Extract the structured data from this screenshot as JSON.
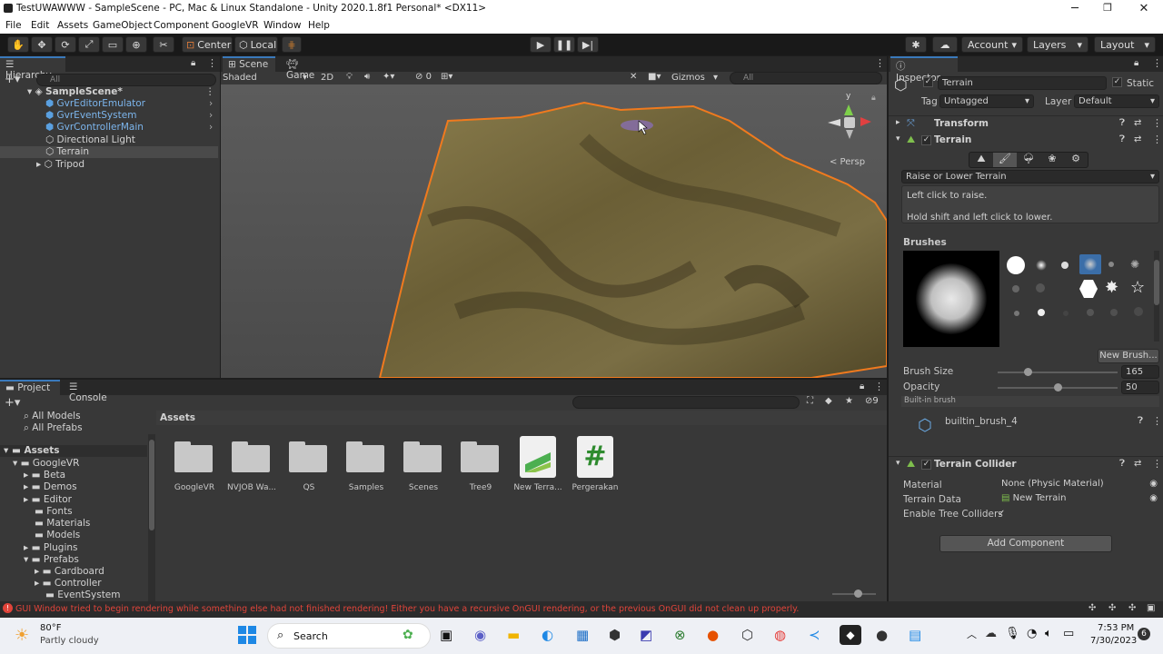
{
  "window": {
    "title": "TestUWAWWW - SampleScene - PC, Mac & Linux Standalone - Unity 2020.1.8f1 Personal* <DX11>"
  },
  "menu": [
    "File",
    "Edit",
    "Assets",
    "GameObject",
    "Component",
    "GoogleVR",
    "Window",
    "Help"
  ],
  "toolbar": {
    "center": "Center",
    "local": "Local",
    "account": "Account",
    "layers": "Layers",
    "layout": "Layout"
  },
  "hierarchy": {
    "tab": "Hierarchy",
    "search_placeholder": "All",
    "scene": "SampleScene*",
    "items": [
      "GvrEditorEmulator",
      "GvrEventSystem",
      "GvrControllerMain",
      "Directional Light",
      "Terrain",
      "Tripod"
    ]
  },
  "scene": {
    "tabs": [
      "Scene",
      "Game"
    ],
    "shading": "Shaded",
    "mode_2d": "2D",
    "hidden_count": "0",
    "gizmos": "Gizmos",
    "search_placeholder": "All",
    "axis_y": "y",
    "persp": "< Persp"
  },
  "inspector": {
    "tab": "Inspector",
    "object_name": "Terrain",
    "static_label": "Static",
    "tag_label": "Tag",
    "tag_value": "Untagged",
    "layer_label": "Layer",
    "layer_value": "Default",
    "transform": "Transform",
    "terrain": "Terrain",
    "tool_mode": "Raise or Lower Terrain",
    "help_line1": "Left click to raise.",
    "help_line2": "Hold shift and left click to lower.",
    "brushes_label": "Brushes",
    "new_brush": "New Brush...",
    "brush_size_label": "Brush Size",
    "brush_size_value": "165",
    "opacity_label": "Opacity",
    "opacity_value": "50",
    "builtin_label": "Built-in brush",
    "brush_name": "builtin_brush_4",
    "collider": "Terrain Collider",
    "material_label": "Material",
    "material_value": "None (Physic Material)",
    "terrain_data_label": "Terrain Data",
    "terrain_data_value": "New Terrain",
    "tree_colliders_label": "Enable Tree Colliders",
    "add_component": "Add Component"
  },
  "project": {
    "tabs": [
      "Project",
      "Console"
    ],
    "favorites": [
      "All Models",
      "All Prefabs"
    ],
    "assets_root": "Assets",
    "tree": [
      "GoogleVR",
      "Beta",
      "Demos",
      "Editor",
      "Fonts",
      "Materials",
      "Models",
      "Plugins",
      "Prefabs",
      "Cardboard",
      "Controller",
      "EventSystem"
    ],
    "breadcrumb": "Assets",
    "hidden_count": "9",
    "assets": [
      "GoogleVR",
      "NVJOB Wa...",
      "QS",
      "Samples",
      "Scenes",
      "Tree9",
      "New Terra...",
      "Pergerakan"
    ]
  },
  "status": {
    "error": "GUI Window tried to begin rendering while something else had not finished rendering! Either you have a recursive OnGUI rendering, or the previous OnGUI did not clean up properly."
  },
  "taskbar": {
    "temp": "80°F",
    "weather": "Partly cloudy",
    "search": "Search",
    "time": "7:53 PM",
    "date": "7/30/2023",
    "notifications": "6"
  },
  "colors": {
    "accent_blue": "#3a79bb",
    "terrain_outline": "#f07a1e",
    "error_red": "#e0443a"
  }
}
